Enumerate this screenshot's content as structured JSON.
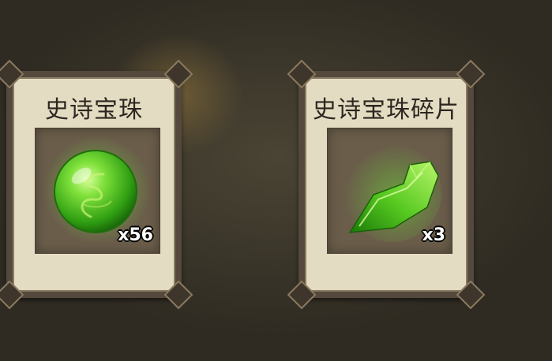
{
  "items": [
    {
      "name": "史诗宝珠",
      "count": "x56",
      "icon": "green-orb-icon"
    },
    {
      "name": "史诗宝珠碎片",
      "count": "x3",
      "icon": "green-shard-icon"
    }
  ],
  "colors": {
    "card_bg": "#e4dcc2",
    "card_border": "#54493c",
    "item_bg": "#6a5d4a",
    "gem_green": "#4ec41e"
  }
}
